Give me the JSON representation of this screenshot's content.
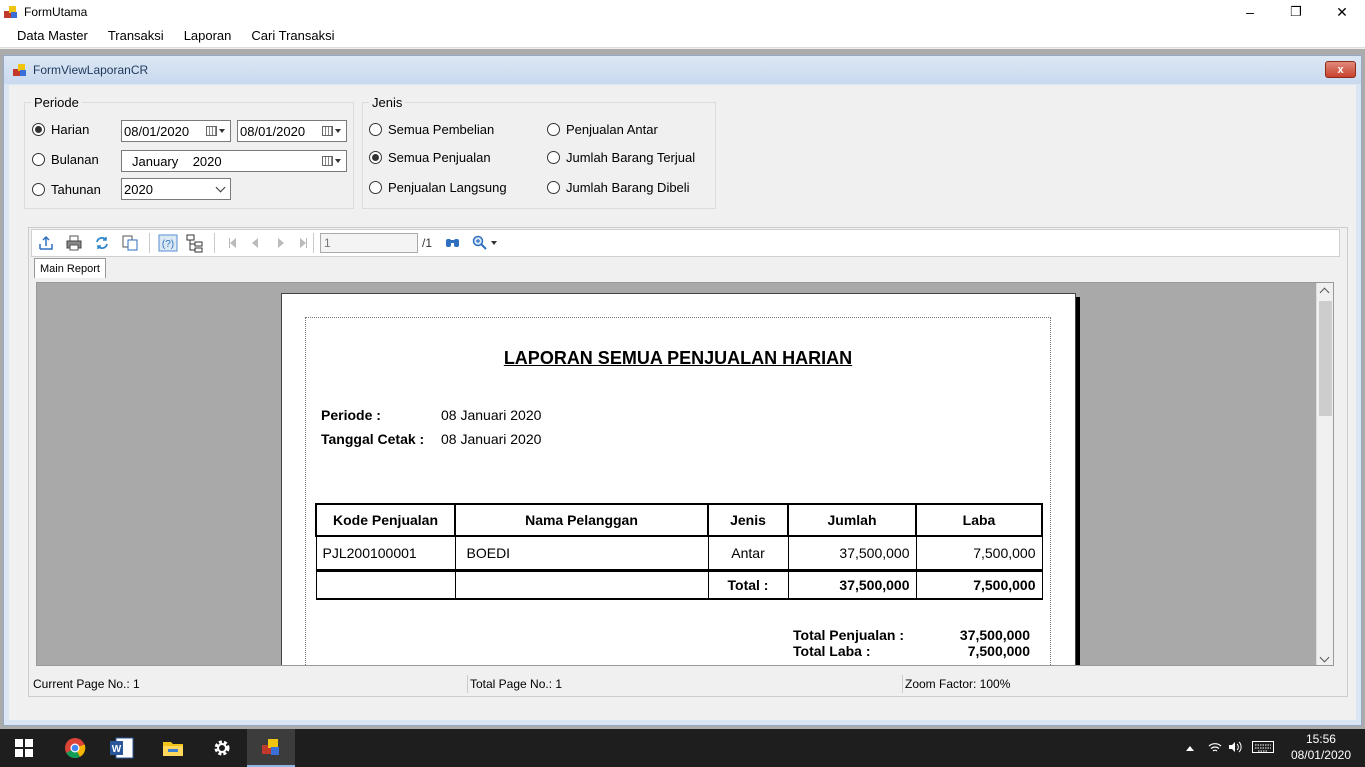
{
  "window": {
    "title": "FormUtama",
    "controls": {
      "minimize": "–",
      "restore": "❐",
      "close": "✕"
    }
  },
  "menu": [
    "Data Master",
    "Transaksi",
    "Laporan",
    "Cari Transaksi"
  ],
  "child": {
    "title": "FormViewLaporanCR",
    "close_label": "x"
  },
  "periode": {
    "legend": "Periode",
    "harian": {
      "label": "Harian",
      "checked": true,
      "from": "08/01/2020",
      "to": "08/01/2020"
    },
    "bulanan": {
      "label": "Bulanan",
      "checked": false,
      "value": "January    2020"
    },
    "tahunan": {
      "label": "Tahunan",
      "checked": false,
      "value": "2020"
    }
  },
  "jenis": {
    "legend": "Jenis",
    "options": [
      {
        "label": "Semua Pembelian",
        "checked": false
      },
      {
        "label": "Semua Penjualan",
        "checked": true
      },
      {
        "label": "Penjualan Langsung",
        "checked": false
      },
      {
        "label": "Penjualan Antar",
        "checked": false
      },
      {
        "label": "Jumlah Barang Terjual",
        "checked": false
      },
      {
        "label": "Jumlah Barang Dibeli",
        "checked": false
      }
    ]
  },
  "viewer": {
    "toolbar_icons": [
      "export-icon",
      "print-icon",
      "refresh-icon",
      "copy-icon",
      "help-icon",
      "group-tree-icon",
      "first-page-icon",
      "previous-page-icon",
      "next-page-icon",
      "last-page-icon",
      "find-icon",
      "zoom-icon"
    ],
    "page_input": "1",
    "page_total": "/1",
    "tab": "Main Report",
    "status": {
      "current_page": "Current Page No.: 1",
      "total_page": "Total Page No.: 1",
      "zoom": "Zoom Factor: 100%"
    }
  },
  "report": {
    "title": "LAPORAN SEMUA PENJUALAN HARIAN",
    "periode_label": "Periode :",
    "periode_value": "08 Januari 2020",
    "cetak_label": "Tanggal Cetak :",
    "cetak_value": "08 Januari 2020",
    "columns": [
      "Kode Penjualan",
      "Nama Pelanggan",
      "Jenis",
      "Jumlah",
      "Laba"
    ],
    "rows": [
      {
        "kode": "PJL200100001",
        "nama": "BOEDI",
        "jenis": "Antar",
        "jumlah": "37,500,000",
        "laba": "7,500,000"
      }
    ],
    "total_label": "Total :",
    "total_jumlah": "37,500,000",
    "total_laba": "7,500,000",
    "total_penjualan_label": "Total Penjualan :",
    "total_penjualan_value": "37,500,000",
    "total_laba_label": "Total Laba :",
    "total_laba_value": "7,500,000"
  },
  "taskbar": {
    "time": "15:56",
    "date": "08/01/2020"
  }
}
